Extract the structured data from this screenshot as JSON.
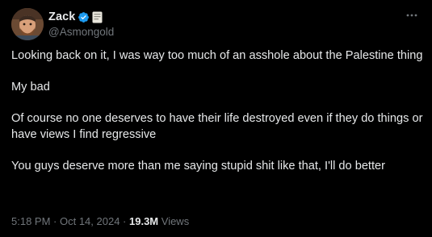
{
  "author": {
    "display_name": "Zack",
    "handle": "@Asmongold",
    "verified": true
  },
  "icons": {
    "verified_badge": "verified-checkmark-icon",
    "affiliate_badge": "affiliate-badge-icon",
    "more": "more-options-icon",
    "accent_color": "#1d9bf0"
  },
  "post": {
    "paragraphs": [
      "Looking back on it, I was way too much of an asshole about the Palestine thing",
      "My bad",
      "Of course no one deserves to have their life destroyed even if they do things or have views I find regressive",
      "You guys deserve more than me saying stupid shit like that, I'll do better"
    ]
  },
  "meta": {
    "time": "5:18 PM",
    "separator": " · ",
    "date": "Oct 14, 2024",
    "views_count": "19.3M",
    "views_label": " Views"
  }
}
